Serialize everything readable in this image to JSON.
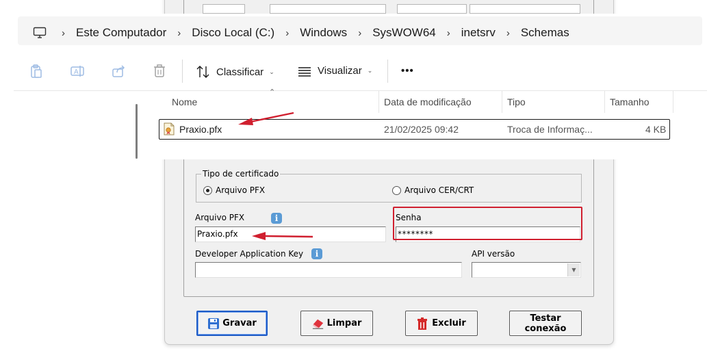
{
  "explorer": {
    "breadcrumb": [
      "Este Computador",
      "Disco Local (C:)",
      "Windows",
      "SysWOW64",
      "inetsrv",
      "Schemas"
    ],
    "commands": {
      "sort_label": "Classificar",
      "view_label": "Visualizar",
      "more_label": "•••"
    },
    "columns": {
      "name": "Nome",
      "modified": "Data de modificação",
      "type": "Tipo",
      "size": "Tamanho"
    },
    "files": [
      {
        "name": "Praxio.pfx",
        "modified": "21/02/2025 09:42",
        "type": "Troca de Informaç...",
        "size": "4 KB",
        "icon": "certificate-file-icon"
      }
    ]
  },
  "form": {
    "cert_group_title": "Tipo de certificado",
    "radio_pfx_label": "Arquivo PFX",
    "radio_cer_label": "Arquivo CER/CRT",
    "selected_cert_type": "Arquivo PFX",
    "pfx_label": "Arquivo PFX",
    "pfx_value": "Praxio.pfx",
    "password_label": "Senha",
    "password_value": "********",
    "dev_key_label": "Developer Application Key",
    "dev_key_value": "",
    "api_version_label": "API versão",
    "api_version_value": ""
  },
  "buttons": {
    "save_label": "Gravar",
    "clear_label": "Limpar",
    "delete_label": "Excluir",
    "test_label_line1": "Testar",
    "test_label_line2": "conexão"
  },
  "colors": {
    "annotation_red": "#d01f2f",
    "info_blue": "#5b9bd5",
    "default_button_border": "#1e5bc6"
  }
}
